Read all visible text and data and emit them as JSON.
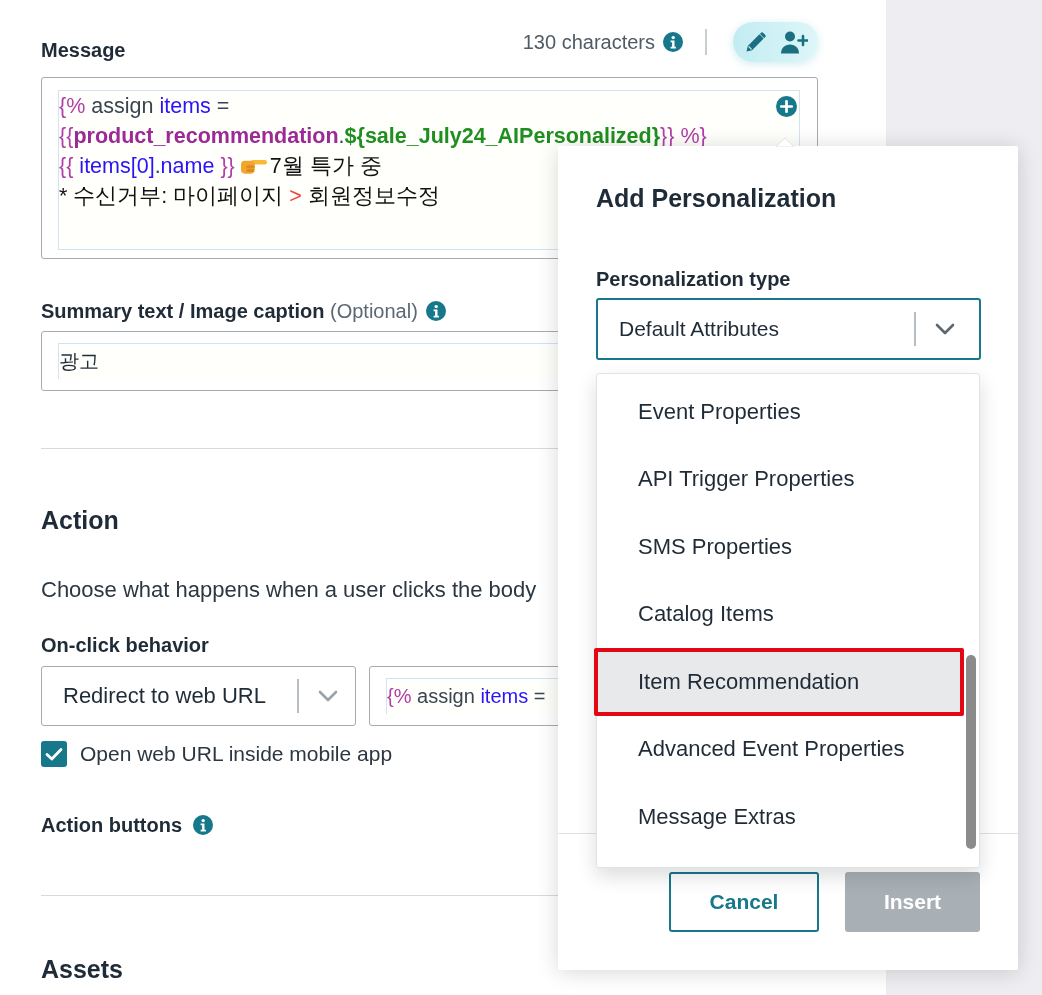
{
  "message": {
    "label": "Message",
    "character_count": "130 characters",
    "lines": [
      [
        {
          "kind": "delimiter",
          "text": "{%"
        },
        {
          "kind": "keyword",
          "text": " assign "
        },
        {
          "kind": "variable",
          "text": "items"
        },
        {
          "kind": "keyword",
          "text": " ="
        }
      ],
      [
        {
          "kind": "delimiter",
          "text": "{{"
        },
        {
          "kind": "object",
          "text": "product_recommendation"
        },
        {
          "kind": "keyword",
          "text": "."
        },
        {
          "kind": "attribute",
          "text": "${sale_July24_AIPersonalized}"
        },
        {
          "kind": "delimiter",
          "text": "}} %}"
        }
      ],
      [
        {
          "kind": "delimiter",
          "text": "{{"
        },
        {
          "kind": "variable",
          "text": " items[0]"
        },
        {
          "kind": "keyword",
          "text": "."
        },
        {
          "kind": "variable",
          "text": "name "
        },
        {
          "kind": "delimiter",
          "text": "}} "
        },
        {
          "kind": "emoji"
        },
        {
          "kind": "text",
          "text": "7월 특가 중"
        }
      ],
      [
        {
          "kind": "text",
          "text": "* 수신거부: 마이페이지 "
        },
        {
          "kind": "operator",
          "text": ">"
        },
        {
          "kind": "text",
          "text": " 회원정보수정"
        }
      ]
    ]
  },
  "caption": {
    "label": "Summary text / Image caption",
    "hint": "(Optional)",
    "value": "광고"
  },
  "action": {
    "heading": "Action",
    "description": "Choose what happens when a user clicks the body",
    "on_click_label": "On-click behavior",
    "behavior": "Redirect to web URL",
    "url_tokens": [
      {
        "kind": "delimiter",
        "text": "{%"
      },
      {
        "kind": "keyword",
        "text": " assign "
      },
      {
        "kind": "variable",
        "text": "items"
      },
      {
        "kind": "keyword",
        "text": " ="
      }
    ],
    "open_in_app": {
      "label": "Open web URL inside mobile app",
      "checked": true
    },
    "buttons_label": "Action buttons"
  },
  "assets": {
    "heading": "Assets"
  },
  "personalization": {
    "title": "Add Personalization",
    "type_label": "Personalization type",
    "type_select": {
      "value": "Default Attributes",
      "open": true
    },
    "options": [
      {
        "label": "Event Properties",
        "selected": false,
        "marked": false
      },
      {
        "label": "API Trigger Properties",
        "selected": false,
        "marked": false
      },
      {
        "label": "SMS Properties",
        "selected": false,
        "marked": false
      },
      {
        "label": "Catalog Items",
        "selected": false,
        "marked": false
      },
      {
        "label": "Item Recommendation",
        "selected": true,
        "marked": true
      },
      {
        "label": "Advanced Event Properties",
        "selected": false,
        "marked": false
      },
      {
        "label": "Message Extras",
        "selected": false,
        "marked": false
      }
    ],
    "buttons": [
      {
        "label": "Cancel",
        "kind": "secondary",
        "disabled": false
      },
      {
        "label": "Insert",
        "kind": "primary",
        "disabled": true
      }
    ]
  }
}
